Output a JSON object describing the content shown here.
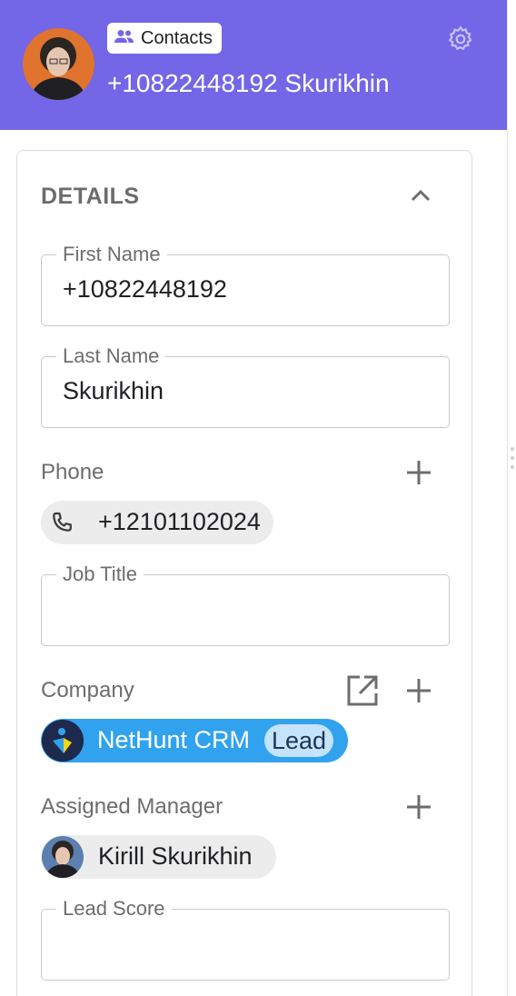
{
  "header": {
    "record_type": "Contacts",
    "record_type_icon": "people-icon",
    "record_title": "+10822448192 Skurikhin",
    "settings_icon": "gear-icon",
    "accent_color": "#7366e7"
  },
  "details": {
    "section_title": "DETAILS",
    "collapse_icon": "chevron-up-icon",
    "first_name": {
      "label": "First Name",
      "value": "+10822448192"
    },
    "last_name": {
      "label": "Last Name",
      "value": "Skurikhin"
    },
    "phone": {
      "label": "Phone",
      "value": "+12101102024",
      "icon": "phone-icon"
    },
    "job_title": {
      "label": "Job Title",
      "value": ""
    },
    "company": {
      "label": "Company",
      "name": "NetHunt CRM",
      "tag": "Lead",
      "chip_color": "#31a2ee"
    },
    "assigned_manager": {
      "label": "Assigned Manager",
      "name": "Kirill Skurikhin"
    },
    "lead_score": {
      "label": "Lead Score",
      "value": ""
    }
  }
}
